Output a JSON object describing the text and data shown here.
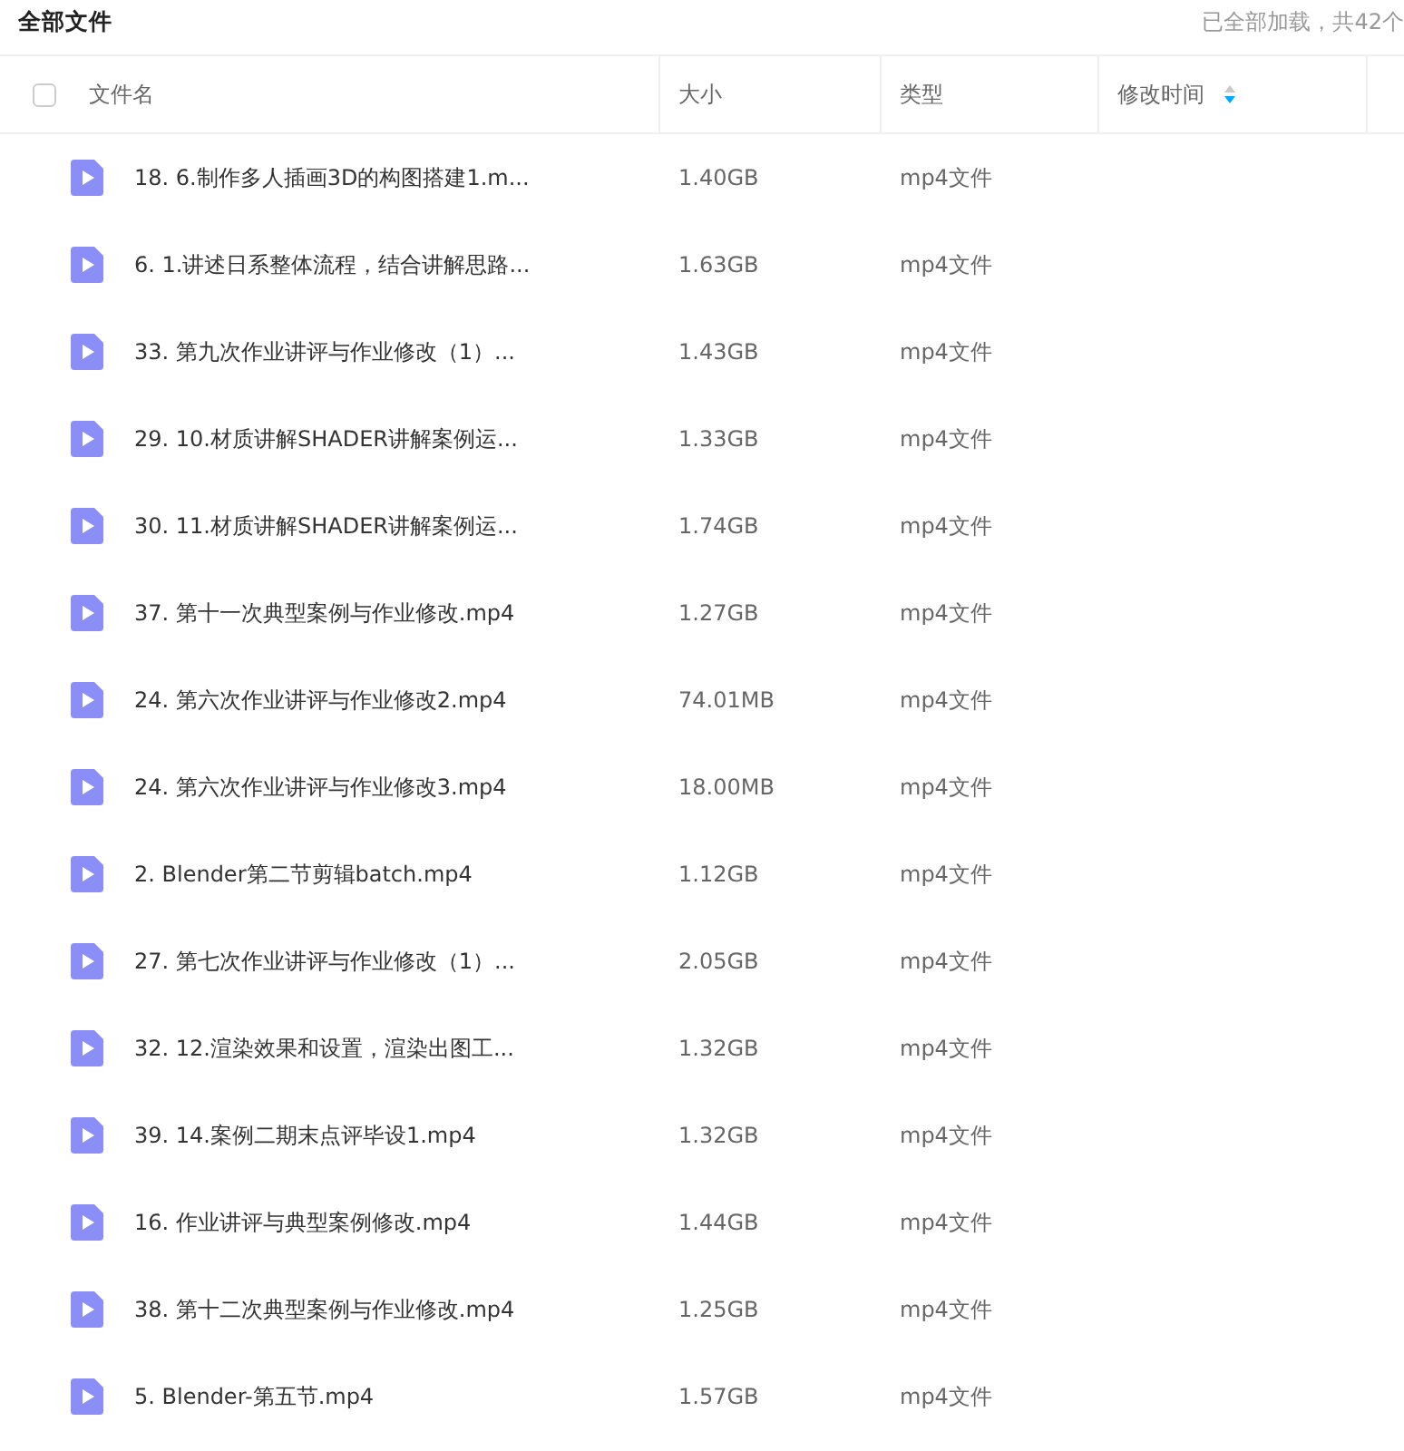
{
  "title": "全部文件",
  "load_status": "已全部加载，共42个",
  "table": {
    "select_all": {
      "checked": false
    },
    "columns": [
      {
        "label": "文件名",
        "sorted": false
      },
      {
        "label": "大小",
        "sorted": false
      },
      {
        "label": "类型",
        "sorted": false
      },
      {
        "label": "修改时间",
        "sorted": true
      }
    ],
    "rows": [
      {
        "name": "18. 6.制作多人插画3D的构图搭建1.m...",
        "size": "1.40GB",
        "type": "mp4文件"
      },
      {
        "name": "6. 1.讲述日系整体流程，结合讲解思路...",
        "size": "1.63GB",
        "type": "mp4文件"
      },
      {
        "name": "33. 第九次作业讲评与作业修改（1）...",
        "size": "1.43GB",
        "type": "mp4文件"
      },
      {
        "name": "29. 10.材质讲解SHADER讲解案例运...",
        "size": "1.33GB",
        "type": "mp4文件"
      },
      {
        "name": "30. 11.材质讲解SHADER讲解案例运...",
        "size": "1.74GB",
        "type": "mp4文件"
      },
      {
        "name": "37. 第十一次典型案例与作业修改.mp4",
        "size": "1.27GB",
        "type": "mp4文件"
      },
      {
        "name": "24. 第六次作业讲评与作业修改2.mp4",
        "size": "74.01MB",
        "type": "mp4文件"
      },
      {
        "name": "24. 第六次作业讲评与作业修改3.mp4",
        "size": "18.00MB",
        "type": "mp4文件"
      },
      {
        "name": "2. Blender第二节剪辑batch.mp4",
        "size": "1.12GB",
        "type": "mp4文件"
      },
      {
        "name": "27. 第七次作业讲评与作业修改（1）...",
        "size": "2.05GB",
        "type": "mp4文件"
      },
      {
        "name": "32. 12.渲染效果和设置，渲染出图工...",
        "size": "1.32GB",
        "type": "mp4文件"
      },
      {
        "name": "39. 14.案例二期末点评毕设1.mp4",
        "size": "1.32GB",
        "type": "mp4文件"
      },
      {
        "name": "16. 作业讲评与典型案例修改.mp4",
        "size": "1.44GB",
        "type": "mp4文件"
      },
      {
        "name": "38. 第十二次典型案例与作业修改.mp4",
        "size": "1.25GB",
        "type": "mp4文件"
      },
      {
        "name": "5. Blender-第五节.mp4",
        "size": "1.57GB",
        "type": "mp4文件"
      }
    ]
  }
}
